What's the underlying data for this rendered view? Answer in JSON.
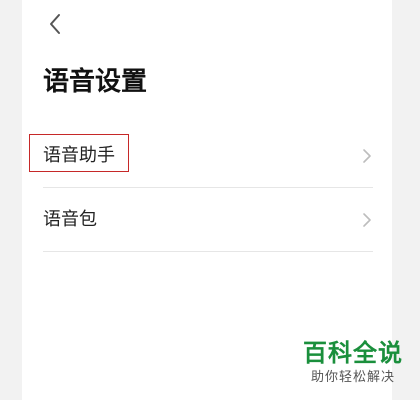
{
  "header": {
    "back_icon": "chevron-left-icon",
    "title": "语音设置"
  },
  "menu": {
    "items": [
      {
        "label": "语音助手",
        "icon": "chevron-right-icon",
        "highlighted": true
      },
      {
        "label": "语音包",
        "icon": "chevron-right-icon",
        "highlighted": false
      }
    ]
  },
  "watermark": {
    "main": "百科全说",
    "sub": "助你轻松解决"
  },
  "colors": {
    "background": "#f2f2f2",
    "screen": "#ffffff",
    "title": "#111111",
    "divider": "#e6e6e6",
    "chevron": "#bdbdbd",
    "highlight": "#c62828",
    "watermark": "#1a8f3c"
  }
}
